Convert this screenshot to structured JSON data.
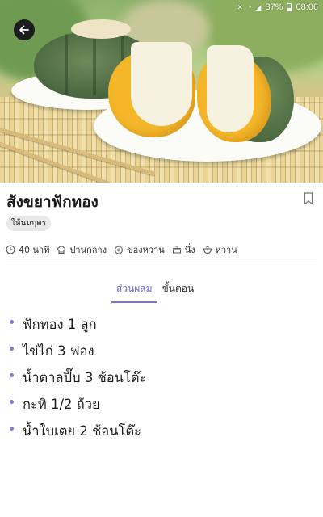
{
  "status_bar": {
    "battery": "37%",
    "time": "08:06"
  },
  "recipe": {
    "title": "สังขยาฟักทอง",
    "serving_badge": "ให้นมบุตร",
    "meta": [
      {
        "icon": "clock-icon",
        "label": "40 นาที"
      },
      {
        "icon": "chef-hat-icon",
        "label": "ปานกลาง"
      },
      {
        "icon": "dessert-icon",
        "label": "ของหวาน"
      },
      {
        "icon": "steamer-icon",
        "label": "นึ่ง"
      },
      {
        "icon": "taste-icon",
        "label": "หวาน"
      }
    ]
  },
  "tabs": [
    {
      "label": "ส่วนผสม",
      "active": true
    },
    {
      "label": "ขั้นตอน",
      "active": false
    }
  ],
  "ingredients": [
    "ฟักทอง 1 ลูก",
    "ไข่ไก่ 3 ฟอง",
    "น้ำตาลปี๊บ 3 ช้อนโต๊ะ",
    "กะทิ 1/2 ถ้วย",
    "น้ำใบเตย 2 ช้อนโต๊ะ"
  ],
  "colors": {
    "accent": "#7777d8",
    "badge_bg": "#e9e9e9"
  }
}
